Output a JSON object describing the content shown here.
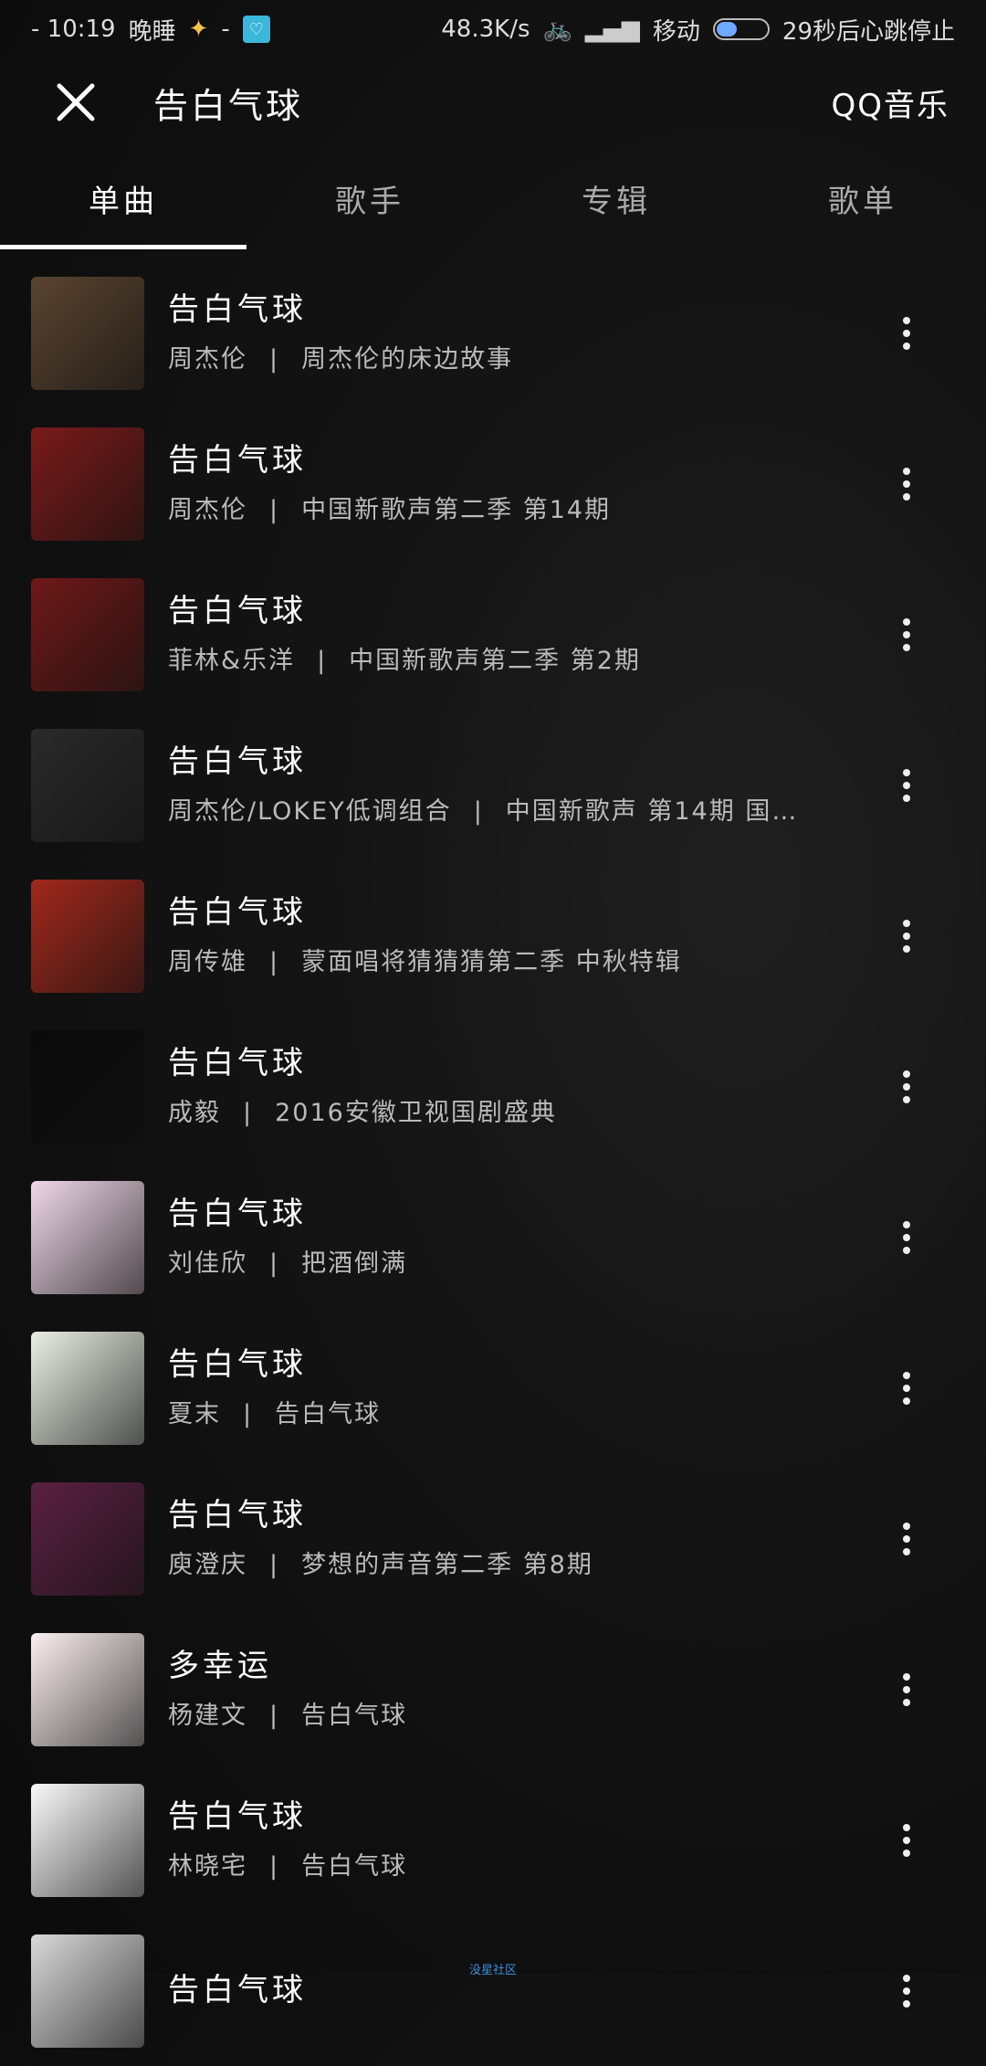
{
  "status_bar": {
    "time": "- 10:19",
    "app_label": "晚睡",
    "dash": "-",
    "net_speed": "48.3K/s",
    "carrier": "移动",
    "timer_text": "29秒后心跳停止"
  },
  "header": {
    "title": "告白气球",
    "brand": "QQ音乐"
  },
  "tabs": [
    {
      "label": "单曲"
    },
    {
      "label": "歌手"
    },
    {
      "label": "专辑"
    },
    {
      "label": "歌单"
    }
  ],
  "songs": [
    {
      "title": "告白气球",
      "artist": "周杰伦",
      "album": "周杰伦的床边故事",
      "cover_color": "#5a4430"
    },
    {
      "title": "告白气球",
      "artist": "周杰伦",
      "album": "中国新歌声第二季 第14期",
      "cover_color": "#7a1a1a"
    },
    {
      "title": "告白气球",
      "artist": "菲林&乐洋",
      "album": "中国新歌声第二季 第2期",
      "cover_color": "#6e1818"
    },
    {
      "title": "告白气球",
      "artist": "周杰伦/LOKEY低调组合",
      "album": "中国新歌声 第14期 国…",
      "cover_color": "#2a2a2a"
    },
    {
      "title": "告白气球",
      "artist": "周传雄",
      "album": "蒙面唱将猜猜猜第二季 中秋特辑",
      "cover_color": "#a0281c"
    },
    {
      "title": "告白气球",
      "artist": "成毅",
      "album": "2016安徽卫视国剧盛典",
      "cover_color": "#0a0a0a"
    },
    {
      "title": "告白气球",
      "artist": "刘佳欣",
      "album": "把酒倒满",
      "cover_color": "#efd8e8"
    },
    {
      "title": "告白气球",
      "artist": "夏末",
      "album": "告白气球",
      "cover_color": "#e9efe4"
    },
    {
      "title": "告白气球",
      "artist": "庾澄庆",
      "album": "梦想的声音第二季 第8期",
      "cover_color": "#5a2040"
    },
    {
      "title": "多幸运",
      "artist": "杨建文",
      "album": "告白气球",
      "cover_color": "#fbeff1"
    },
    {
      "title": "告白气球",
      "artist": "林晓宅",
      "album": "告白气球",
      "cover_color": "#fafafa"
    },
    {
      "title": "告白气球",
      "artist": "",
      "album": "",
      "cover_color": "#d9d9d9"
    }
  ],
  "watermark": "没星社区"
}
